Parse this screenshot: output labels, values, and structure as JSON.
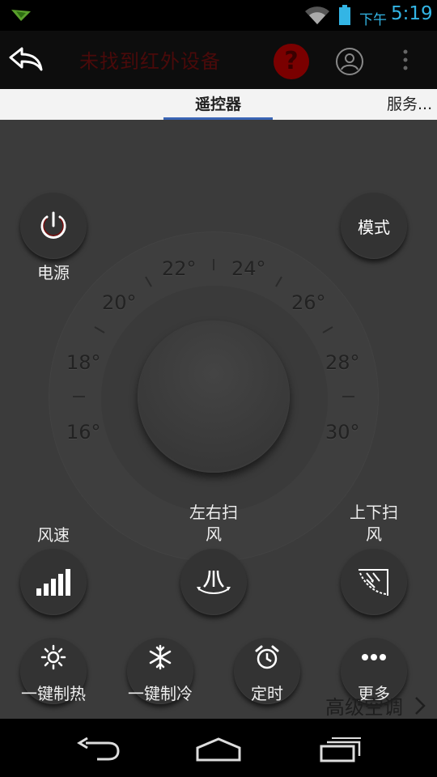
{
  "status_bar": {
    "ampm": "下午",
    "time": "5:19"
  },
  "action_bar": {
    "title": "未找到红外设备",
    "help_label": "?"
  },
  "tabs": {
    "remote": "遥控器",
    "service": "服务..."
  },
  "dial": {
    "temps": [
      "16°",
      "18°",
      "20°",
      "22°",
      "24°",
      "26°",
      "28°",
      "30°"
    ]
  },
  "controls": {
    "power": "电源",
    "mode": "模式",
    "fan_speed": "风速",
    "swing_horizontal_line1": "左右扫",
    "swing_horizontal_line2": "风",
    "swing_vertical_line1": "上下扫",
    "swing_vertical_line2": "风",
    "one_key_heat": "一键制热",
    "one_key_cool": "一键制冷",
    "timer": "定时",
    "more": "更多",
    "advanced": "高级空调"
  },
  "colors": {
    "accent": "#33b5e5",
    "tab_indicator": "#3a64b4"
  }
}
